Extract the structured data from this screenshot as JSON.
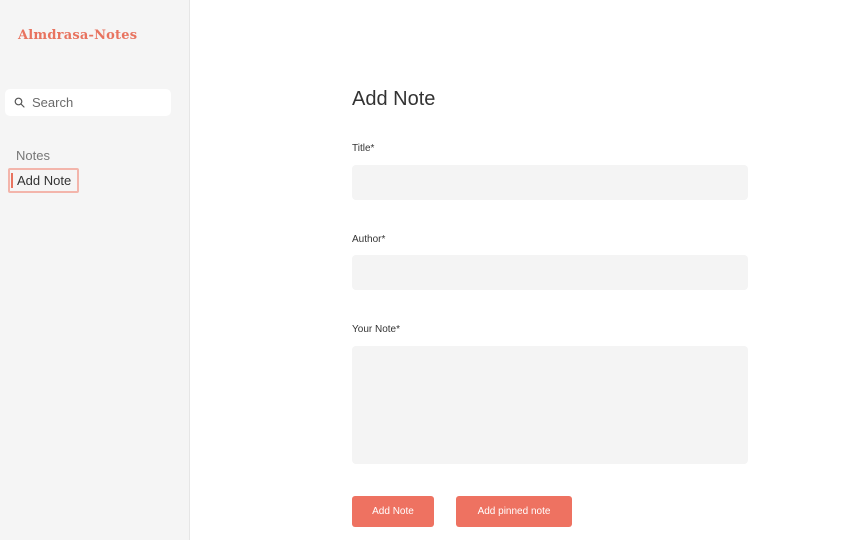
{
  "sidebar": {
    "brand": "Almdrasa-Notes",
    "search": {
      "placeholder": "Search",
      "icon": "search-icon"
    },
    "nav": {
      "notes_label": "Notes",
      "add_note_label": "Add Note"
    }
  },
  "main": {
    "heading": "Add Note",
    "title_label": "Title*",
    "title_value": "",
    "author_label": "Author*",
    "author_value": "",
    "note_label": "Your Note*",
    "note_value": "",
    "add_button_label": "Add Note",
    "add_pinned_button_label": "Add pinned note"
  },
  "colors": {
    "accent": "#ee7261",
    "brand": "#e8735f",
    "sidebar_bg": "#f5f5f5",
    "field_bg": "#f4f4f4",
    "active_outline": "#f3b5ab"
  }
}
